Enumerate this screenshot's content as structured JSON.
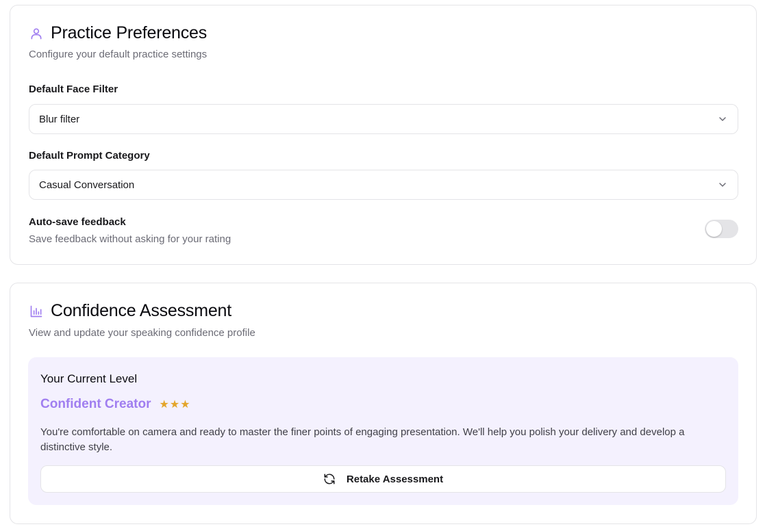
{
  "practice": {
    "title": "Practice Preferences",
    "subtitle": "Configure your default practice settings",
    "icon": "user-icon",
    "face_filter": {
      "label": "Default Face Filter",
      "value": "Blur filter"
    },
    "prompt_category": {
      "label": "Default Prompt Category",
      "value": "Casual Conversation"
    },
    "autosave": {
      "label": "Auto-save feedback",
      "description": "Save feedback without asking for your rating",
      "enabled": false
    }
  },
  "confidence": {
    "title": "Confidence Assessment",
    "subtitle": "View and update your speaking confidence profile",
    "icon": "bar-chart-icon",
    "current_level": {
      "heading": "Your Current Level",
      "name": "Confident Creator",
      "stars": "★★★",
      "description": "You're comfortable on camera and ready to master the finer points of engaging presentation. We'll help you polish your delivery and develop a distinctive style."
    },
    "retake_label": "Retake Assessment"
  },
  "colors": {
    "accent": "#a07ef0",
    "star": "#e3a52a",
    "level_bg": "#f4f1fe",
    "border": "#e4e4e7"
  }
}
